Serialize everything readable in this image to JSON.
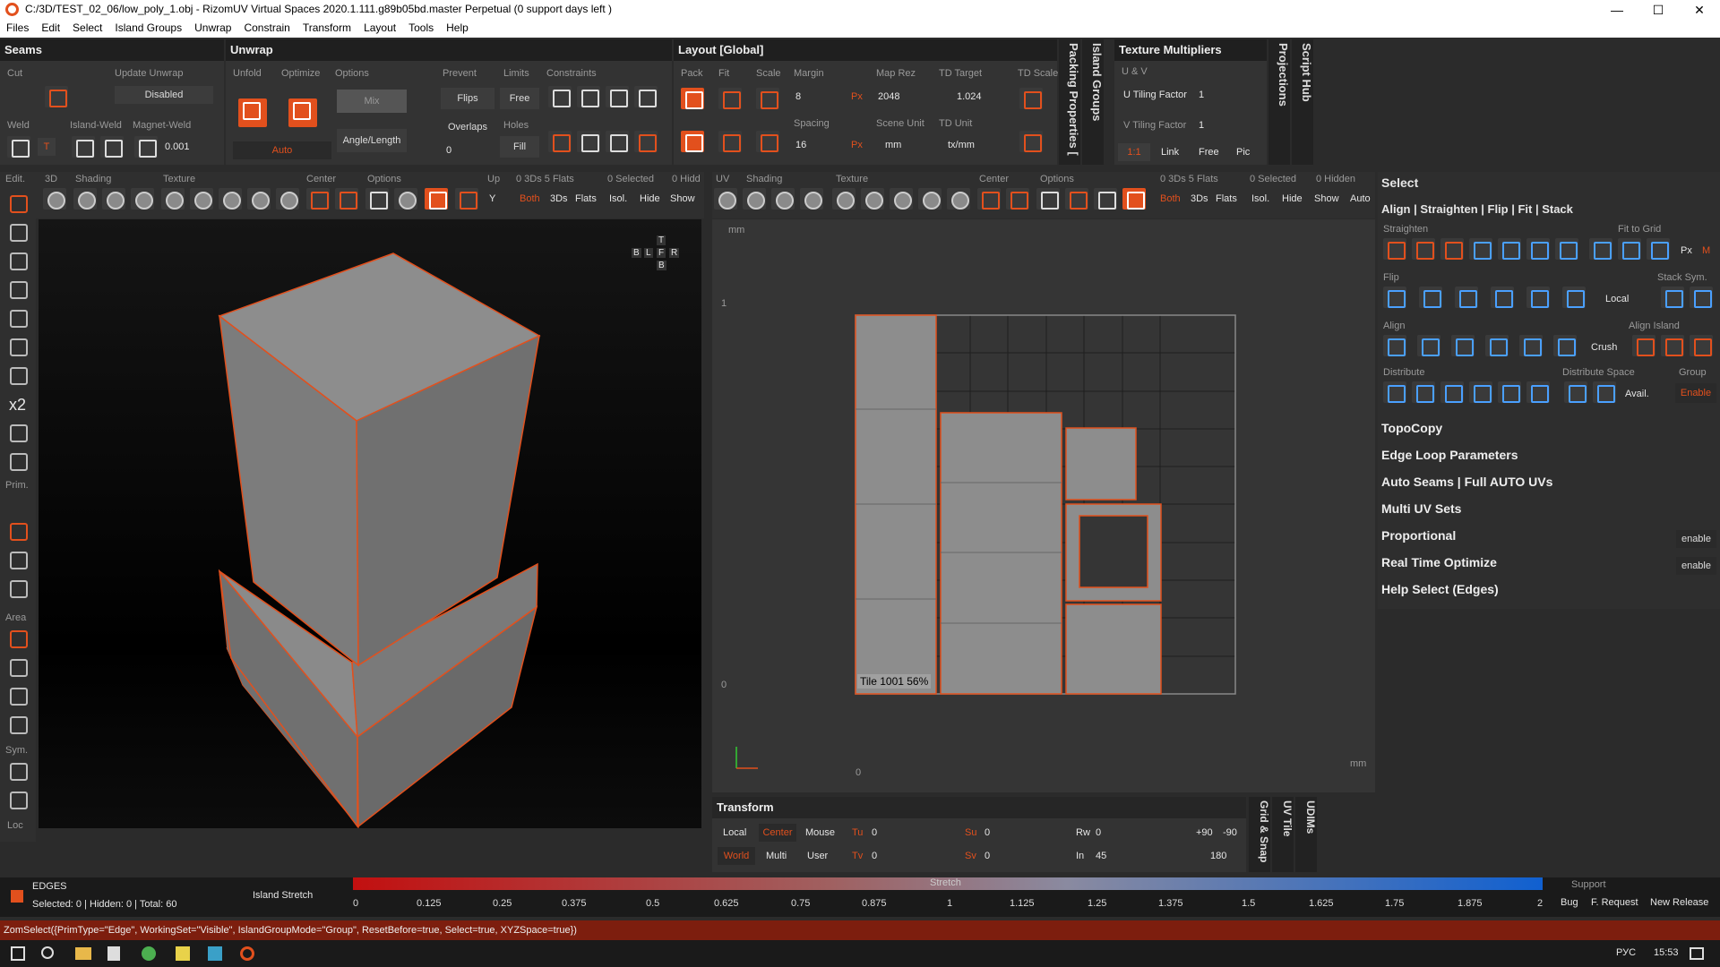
{
  "window": {
    "title": "C:/3D/TEST_02_06/low_poly_1.obj - RizomUV  Virtual Spaces 2020.1.111.g89b05bd.master Perpetual  (0 support days left )",
    "min": "—",
    "max": "☐",
    "close": "✕"
  },
  "menu": [
    "Files",
    "Edit",
    "Select",
    "Island Groups",
    "Unwrap",
    "Constrain",
    "Transform",
    "Layout",
    "Tools",
    "Help"
  ],
  "seams": {
    "title": "Seams",
    "cut": "Cut",
    "update_unwrap": "Update Unwrap",
    "disabled": "Disabled",
    "weld": "Weld",
    "island_weld": "Island-Weld",
    "magnet_weld": "Magnet-Weld",
    "magnet_value": "0.001",
    "t": "T"
  },
  "unwrap": {
    "title": "Unwrap",
    "unfold": "Unfold",
    "optimize": "Optimize",
    "options": "Options",
    "mix": "Mix",
    "angle_length": "Angle/Length",
    "auto": "Auto",
    "prevent": "Prevent",
    "flips": "Flips",
    "overlaps": "Overlaps",
    "overlaps_val": "0",
    "limits": "Limits",
    "free": "Free",
    "holes": "Holes",
    "fill": "Fill",
    "constraints": "Constraints"
  },
  "layout": {
    "title": "Layout [Global]",
    "pack": "Pack",
    "fit": "Fit",
    "scale": "Scale",
    "margin": "Margin",
    "margin_val": "8",
    "spacing": "Spacing",
    "spacing_val": "16",
    "px": "Px",
    "map_rez": "Map Rez",
    "map_rez_val": "2048",
    "scene_unit": "Scene Unit",
    "scene_unit_val": "mm",
    "td_target": "TD Target",
    "td_target_val": "1.024",
    "td_unit": "TD Unit",
    "td_unit_val": "tx/mm",
    "td_scale": "TD Scale"
  },
  "vtabs": {
    "packing": "Packing Properties [",
    "island_groups": "Island Groups",
    "projections": "Projections",
    "script_hub": "Script Hub",
    "grid_snap": "Grid & Snap",
    "uv_tile": "UV Tile",
    "udims": "UDIMs"
  },
  "texmult": {
    "title": "Texture Multipliers",
    "uv": "U & V",
    "u_label": "U Tiling Factor",
    "u_val": "1",
    "v_label": "V Tiling Factor",
    "v_val": "1",
    "one": "1:1",
    "link": "Link",
    "free": "Free",
    "pic": "Pic"
  },
  "vp3d_toolbar": {
    "edit": "Edit.",
    "d3": "3D",
    "shading": "Shading",
    "texture": "Texture",
    "center": "Center",
    "options": "Options",
    "up": "Up",
    "y": "Y",
    "info": "0 3Ds 5 Flats",
    "selected": "0 Selected",
    "hidden": "0 Hidd",
    "both": "Both",
    "d3s": "3Ds",
    "flats": "Flats",
    "isol": "Isol.",
    "hide": "Hide",
    "show": "Show"
  },
  "left_tools": {
    "x2": "x2",
    "prim": "Prim.",
    "area": "Area",
    "sym": "Sym.",
    "loc": "Loc"
  },
  "viewcube": {
    "t": "T",
    "b": "B",
    "l": "L",
    "f": "F",
    "r": "R",
    "bb": "B"
  },
  "uv_toolbar": {
    "uv": "UV",
    "shading": "Shading",
    "texture": "Texture",
    "center": "Center",
    "options": "Options",
    "info": "0 3Ds 5 Flats",
    "selected": "0 Selected",
    "hidden": "0 Hidden",
    "both": "Both",
    "d3s": "3Ds",
    "flats": "Flats",
    "isol": "Isol.",
    "hide": "Hide",
    "show": "Show",
    "auto": "Auto"
  },
  "uvview": {
    "mm_top": "mm",
    "one": "1",
    "zero_left": "0",
    "zero_bottom": "0",
    "mm_right": "mm",
    "tile_label": "Tile 1001 56%"
  },
  "select_panel": {
    "title": "Select",
    "subtitle": "Align | Straighten | Flip | Fit | Stack",
    "straighten": "Straighten",
    "fit_to_grid": "Fit to Grid",
    "px": "Px",
    "m": "M",
    "flip": "Flip",
    "stack_sym": "Stack Sym.",
    "local": "Local",
    "align": "Align",
    "align_island": "Align Island",
    "crush": "Crush",
    "distribute": "Distribute",
    "distribute_space": "Distribute Space",
    "group": "Group",
    "avail": "Avail.",
    "enable": "Enable"
  },
  "sections": [
    {
      "label": "TopoCopy",
      "btn": ""
    },
    {
      "label": "Edge Loop Parameters",
      "btn": ""
    },
    {
      "label": "Auto Seams | Full AUTO UVs",
      "btn": ""
    },
    {
      "label": "Multi UV Sets",
      "btn": ""
    },
    {
      "label": "Proportional",
      "btn": "enable"
    },
    {
      "label": "Real Time Optimize",
      "btn": "enable"
    },
    {
      "label": "Help Select (Edges)",
      "btn": ""
    }
  ],
  "transform": {
    "title": "Transform",
    "local": "Local",
    "center": "Center",
    "mouse": "Mouse",
    "world": "World",
    "multi": "Multi",
    "user": "User",
    "tu": "Tu",
    "tu_val": "0",
    "tv": "Tv",
    "tv_val": "0",
    "su": "Su",
    "su_val": "0",
    "sv": "Sv",
    "sv_val": "0",
    "rw": "Rw",
    "rw_val": "0",
    "in": "In",
    "in_val": "45",
    "p90": "+90",
    "m90": "-90",
    "r180": "180"
  },
  "status": {
    "mode": "EDGES",
    "counts": "Selected: 0 | Hidden: 0 | Total: 60",
    "island_stretch": "Island Stretch",
    "stretch": "Stretch",
    "ticks": [
      "0",
      "0.125",
      "0.25",
      "0.375",
      "0.5",
      "0.625",
      "0.75",
      "0.875",
      "1",
      "1.125",
      "1.25",
      "1.375",
      "1.5",
      "1.625",
      "1.75",
      "1.875",
      "2"
    ],
    "support": "Support",
    "bug": "Bug",
    "freq": "F. Request",
    "new_release": "New Release"
  },
  "command": "ZomSelect({PrimType=\"Edge\", WorkingSet=\"Visible\", IslandGroupMode=\"Group\", ResetBefore=true, Select=true, XYZSpace=true})",
  "taskbar": {
    "lang": "РУС",
    "time": "15:53"
  },
  "colors": {
    "accent": "#e2501d",
    "panel": "#333333",
    "header": "#1f1f1f"
  }
}
